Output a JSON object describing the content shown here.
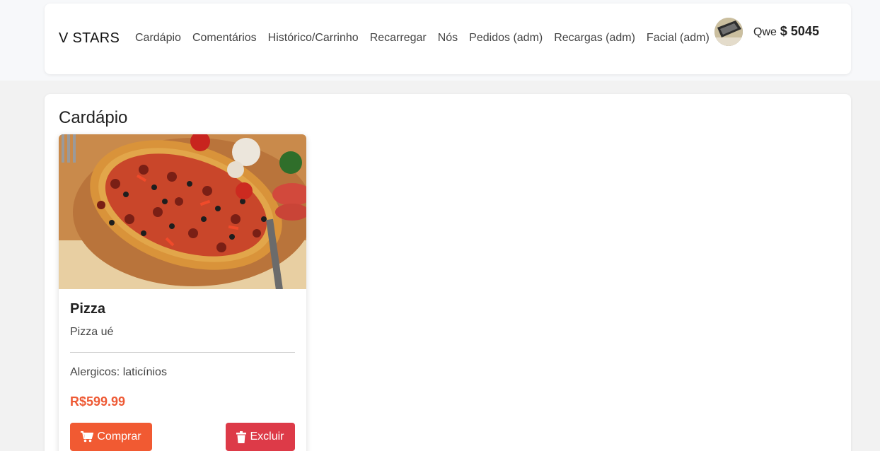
{
  "nav": {
    "brand": "V STARS",
    "links": [
      "Cardápio",
      "Comentários",
      "Histórico/Carrinho",
      "Recarregar",
      "Nós",
      "Pedidos (adm)",
      "Recargas (adm)",
      "Facial (adm)"
    ],
    "user_name": "Qwe",
    "balance": "$ 5045"
  },
  "page": {
    "title": "Cardápio"
  },
  "menu": {
    "items": [
      {
        "name": "Pizza",
        "description": "Pizza ué",
        "allergens": "Alergicos: laticínios",
        "price": "R$599.99",
        "buy_label": "Comprar",
        "delete_label": "Excluir"
      }
    ]
  },
  "icons": {
    "cart": "cart-icon",
    "trash": "trash-icon"
  },
  "colors": {
    "price": "#ee5a35",
    "buy_button": "#f15a32",
    "delete_button": "#dd3a48"
  }
}
